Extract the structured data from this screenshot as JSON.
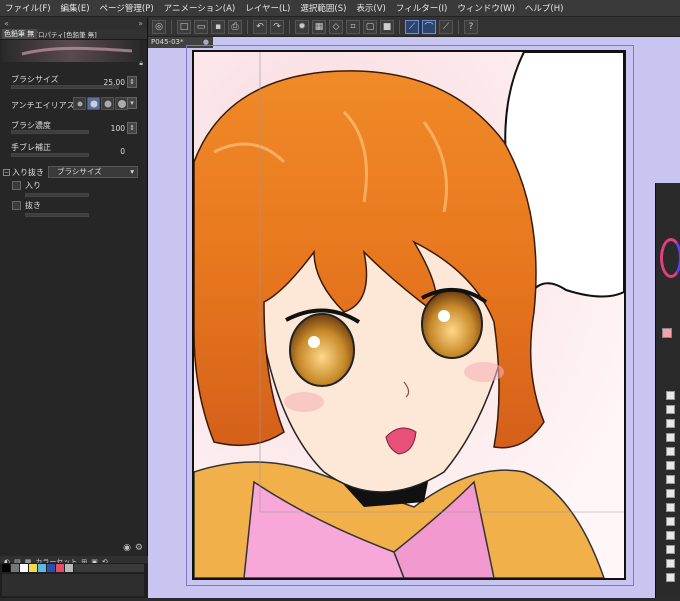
{
  "menu": [
    "ファイル(F)",
    "編集(E)",
    "ページ管理(P)",
    "アニメーション(A)",
    "レイヤー(L)",
    "選択範囲(S)",
    "表示(V)",
    "フィルター(I)",
    "ウィンドウ(W)",
    "ヘルプ(H)"
  ],
  "left_panel": {
    "tab_label": "ツールプロパティ[色鉛筆 無]",
    "brush_name": "色鉛筆 無",
    "properties": {
      "brush_size_label": "ブラシサイズ",
      "brush_size_value": "25.00",
      "antialias_label": "アンチエイリアス",
      "brush_density_label": "ブラシ濃度",
      "brush_density_value": "100",
      "stabilization_label": "手ブレ補正",
      "stabilization_value": "0",
      "taper_label": "入り抜き",
      "taper_mode": "ブラシサイズ",
      "start_label": "入り",
      "end_label": "抜き"
    },
    "color_set_label": "カラーセット",
    "color_set_name": "黒"
  },
  "document": {
    "tab_title": "P045-03*"
  },
  "colors": {
    "accent": "#6a8fd8",
    "canvas_bg": "#c8c6f0",
    "hair": "#e8781e"
  }
}
